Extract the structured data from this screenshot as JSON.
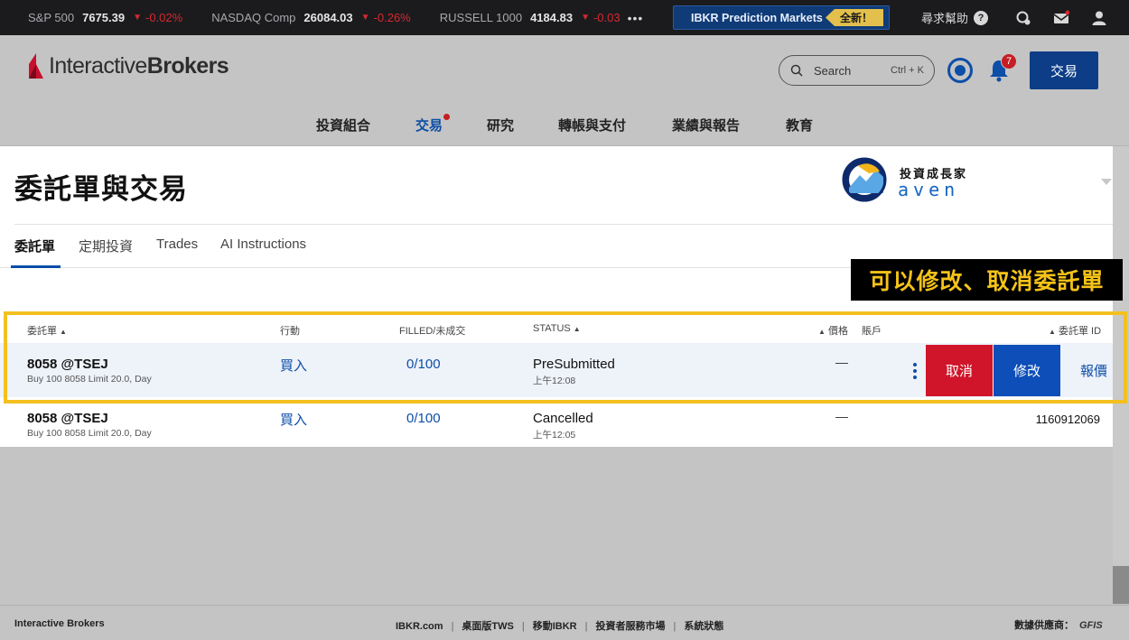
{
  "ticker": {
    "items": [
      {
        "name": "S&P 500",
        "value": "7675.39",
        "change": "-0.02%"
      },
      {
        "name": "NASDAQ Comp",
        "value": "26084.03",
        "change": "-0.26%"
      },
      {
        "name": "RUSSELL 1000",
        "value": "4184.83",
        "change": "-0.03"
      }
    ],
    "more": "•••",
    "promo_label": "IBKR Prediction Markets",
    "promo_badge": "全新！",
    "help_label": "尋求幫助",
    "help_icon": "?"
  },
  "header": {
    "logo_light": "Interactive",
    "logo_bold": "Brokers",
    "search_placeholder": "Search",
    "search_shortcut": "Ctrl + K",
    "notification_count": "7",
    "trade_button": "交易"
  },
  "nav": {
    "items": [
      "投資組合",
      "交易",
      "研究",
      "轉帳與支付",
      "業績與報告",
      "教育"
    ]
  },
  "page": {
    "title": "委託單與交易",
    "brand_name": "投資成長家",
    "brand_sub": "aven",
    "tabs": [
      "委託單",
      "定期投資",
      "Trades",
      "AI Instructions"
    ],
    "callout": "可以修改、取消委託單"
  },
  "table": {
    "headers": {
      "order": "委託單",
      "action": "行動",
      "filled": "FILLED/未成交",
      "status": "STATUS",
      "price": "價格",
      "account": "賬戶",
      "order_id": "委託單 ID"
    },
    "rows": [
      {
        "symbol": "8058 @TSEJ",
        "desc": "Buy 100 8058 Limit 20.0, Day",
        "action": "買入",
        "filled": "0/100",
        "status": "PreSubmitted",
        "time": "上午12:08",
        "price": "—",
        "order_id": ""
      },
      {
        "symbol": "8058 @TSEJ",
        "desc": "Buy 100 8058 Limit 20.0, Day",
        "action": "買入",
        "filled": "0/100",
        "status": "Cancelled",
        "time": "上午12:05",
        "price": "—",
        "order_id": "1160912069"
      }
    ],
    "row_actions": {
      "cancel": "取消",
      "modify": "修改",
      "quote": "報價"
    }
  },
  "footer": {
    "brand": "Interactive Brokers",
    "links": [
      "IBKR.com",
      "桌面版TWS",
      "移動IBKR",
      "投資者服務市場",
      "系統狀態"
    ],
    "data_provider_label": "數據供應商：",
    "data_provider": "GFIS"
  },
  "colors": {
    "accent": "#0c4ea8",
    "danger": "#d0152a",
    "highlight": "#f3c020",
    "ticker_bg": "#1b1b1e"
  }
}
